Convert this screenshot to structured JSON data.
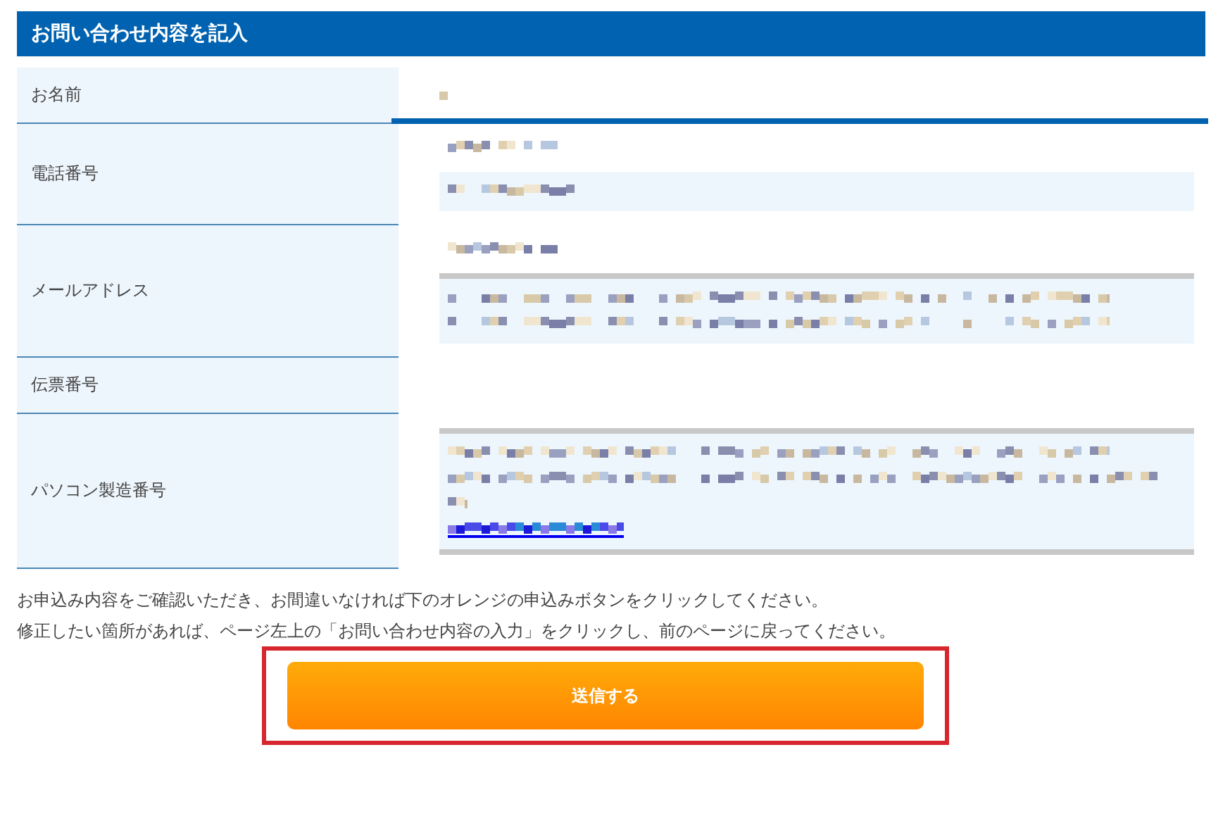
{
  "header": {
    "title": "お問い合わせ内容を記入"
  },
  "rows": [
    {
      "label": "お名前",
      "selected": true,
      "blocks": [
        {
          "kind": "plain",
          "lines": [
            {
              "kind": "short"
            }
          ]
        }
      ]
    },
    {
      "label": "電話番号",
      "selected": false,
      "blocks": [
        {
          "kind": "plain",
          "lines": [
            {
              "kind": "medium"
            }
          ]
        },
        {
          "kind": "boxed",
          "lines": [
            {
              "kind": "medium"
            }
          ]
        }
      ]
    },
    {
      "label": "メールアドレス",
      "selected": false,
      "blocks": [
        {
          "kind": "plain",
          "lines": [
            {
              "kind": "medium"
            }
          ]
        },
        {
          "kind": "boxed-top-rule",
          "lines": [
            {
              "kind": "long"
            },
            {
              "kind": "long"
            }
          ]
        }
      ]
    },
    {
      "label": "伝票番号",
      "selected": false,
      "blocks": []
    },
    {
      "label": "パソコン製造番号",
      "selected": false,
      "blocks": [
        {
          "kind": "boxed-ruled",
          "lines": [
            {
              "kind": "long"
            },
            {
              "kind": "full"
            },
            {
              "kind": "tiny"
            },
            {
              "kind": "link"
            }
          ]
        }
      ]
    }
  ],
  "notes": [
    "お申込み内容をご確認いただき、お間違いなければ下のオレンジの申込みボタンをクリックしてください。",
    "修正したい箇所があれば、ページ左上の「お問い合わせ内容の入力」をクリックし、前のページに戻ってください。"
  ],
  "submit": {
    "label": "送信する",
    "highlighted": true
  }
}
